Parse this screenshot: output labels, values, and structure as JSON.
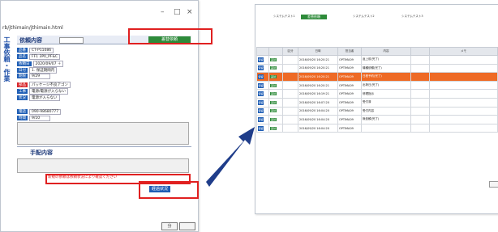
{
  "left_window": {
    "url": "rb/jthimain/jthimain.html",
    "nav_label": "工事依頼・作業",
    "section_title": "依頼内容",
    "status_badge": "差替依頼",
    "order_section": "手配内容",
    "note_text": "新規の依頼は依頼状況により確認ください",
    "confirm_button": "経過状況",
    "close_buttons": [
      "分"
    ],
    "rows": [
      {
        "label": "品番",
        "value": "CT-P11086"
      },
      {
        "label": "品名",
        "value": "FF1 3P0_PF&C"
      },
      {
        "label": "依頼日",
        "value": "2020/09/07 ＋"
      },
      {
        "label": "日付",
        "value": "1. 保証期間内"
      },
      {
        "label": "期限",
        "value": "9/29"
      },
      {
        "label": "部品",
        "value": "パッケージ不良アゴン"
      },
      {
        "label": "工事",
        "value": "電源/電源が入らない"
      },
      {
        "label": "状況",
        "value": "電源が入らない"
      },
      {
        "label": "電話",
        "value": "090-98680777"
      },
      {
        "label": "時間",
        "value": "9/10"
      }
    ]
  },
  "right_window": {
    "header_badge": "差替依頼",
    "header_fields": [
      "システムテスト1",
      "システムテスト2",
      "システムテスト3"
    ],
    "columns": [
      "",
      "",
      "区分",
      "日時",
      "担当者",
      "内容",
      "",
      "メモ"
    ],
    "rows": [
      {
        "c1": "保留",
        "c2": "差替",
        "c3": "2016/09/20 16:20:21",
        "c4": "OPTIMA09",
        "c5": "返上前(完了)"
      },
      {
        "c1": "保留",
        "c2": "差替",
        "c3": "2016/09/20 16:20:21",
        "c4": "OPTIMA09",
        "c5": "機種依頼(完了)"
      },
      {
        "c1": "保留",
        "c2": "差替",
        "c3": "2016/09/20 16:20:21",
        "c4": "OPTIMA09",
        "c5": "日程予約(完了)"
      },
      {
        "c1": "保留",
        "c2": "差替",
        "c3": "2016/09/20 16:20:21",
        "c4": "OPTIMA09",
        "c5": "出荷日(完了)"
      },
      {
        "c1": "保留",
        "c2": "差替",
        "c3": "2016/09/20 16:19:21",
        "c4": "OPTIMA09",
        "c5": "修理指示"
      },
      {
        "c1": "保留",
        "c2": "差替",
        "c3": "2016/09/20 16:07:20",
        "c4": "OPTIMA09",
        "c5": "受付済"
      },
      {
        "c1": "保留",
        "c2": "差替",
        "c3": "2016/09/20 16:04:20",
        "c4": "OPTIMA09",
        "c5": "受付内容"
      },
      {
        "c1": "保留",
        "c2": "差替",
        "c3": "2016/09/20 16:04:20",
        "c4": "OPTIMA09",
        "c5": "無依頼(完了)"
      },
      {
        "c1": "保留",
        "c2": "差替",
        "c3": "2016/09/20 16:04:20",
        "c4": "OPTIMA09",
        "c5": ""
      }
    ],
    "highlight_row": 2
  }
}
